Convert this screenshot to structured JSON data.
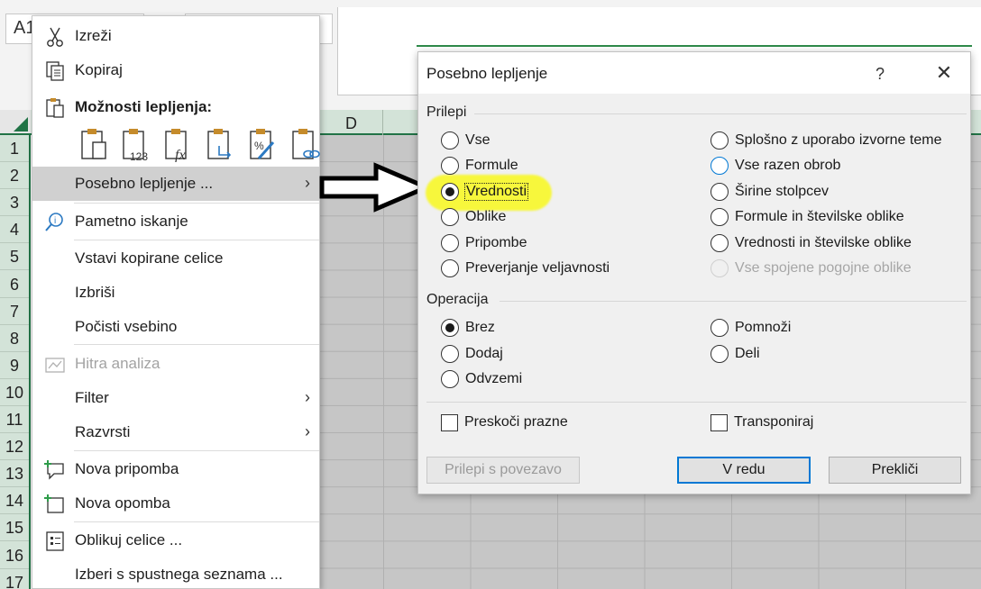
{
  "excel": {
    "namebox": "A1",
    "column_header": "D",
    "row_numbers": [
      "1",
      "2",
      "3",
      "4",
      "5",
      "6",
      "7",
      "8",
      "9",
      "10",
      "11",
      "12",
      "13",
      "14",
      "15",
      "16",
      "17"
    ]
  },
  "context_menu": {
    "cut": "Izreži",
    "copy": "Kopiraj",
    "paste_options": "Možnosti lepljenja:",
    "paste_special": "Posebno lepljenje ...",
    "smart_lookup": "Pametno iskanje",
    "insert_copied": "Vstavi kopirane celice",
    "delete": "Izbriši",
    "clear_contents": "Počisti vsebino",
    "quick_analysis": "Hitra analiza",
    "filter": "Filter",
    "sort": "Razvrsti",
    "new_comment": "Nova pripomba",
    "new_note": "Nova opomba",
    "format_cells": "Oblikuj celice ...",
    "pick_from_list": "Izberi s spustnega seznama ...",
    "paste_icons": [
      "paste-icon",
      "paste-values-icon",
      "paste-formulas-icon",
      "paste-transpose-icon",
      "paste-formatting-icon",
      "paste-link-icon"
    ]
  },
  "dialog": {
    "title": "Posebno lepljenje",
    "help": "?",
    "close": "✕",
    "paste_group": "Prilepi",
    "paste_options_left": [
      "Vse",
      "Formule",
      "Vrednosti",
      "Oblike",
      "Pripombe",
      "Preverjanje veljavnosti"
    ],
    "paste_options_right": [
      "Splošno z uporabo izvorne teme",
      "Vse razen obrob",
      "Širine stolpcev",
      "Formule in številske oblike",
      "Vrednosti in številske oblike",
      "Vse spojene pogojne oblike"
    ],
    "selected_paste": "Vrednosti",
    "operation_group": "Operacija",
    "operation_left": [
      "Brez",
      "Dodaj",
      "Odvzemi"
    ],
    "operation_right": [
      "Pomnoži",
      "Deli"
    ],
    "selected_operation": "Brez",
    "skip_blanks": "Preskoči prazne",
    "transpose": "Transponiraj",
    "paste_link_button": "Prilepi s povezavo",
    "ok_button": "V redu",
    "cancel_button": "Prekliči"
  },
  "colors": {
    "excel_green": "#217346",
    "highlight_yellow": "#f7f73c",
    "focus_blue": "#0078d4"
  }
}
